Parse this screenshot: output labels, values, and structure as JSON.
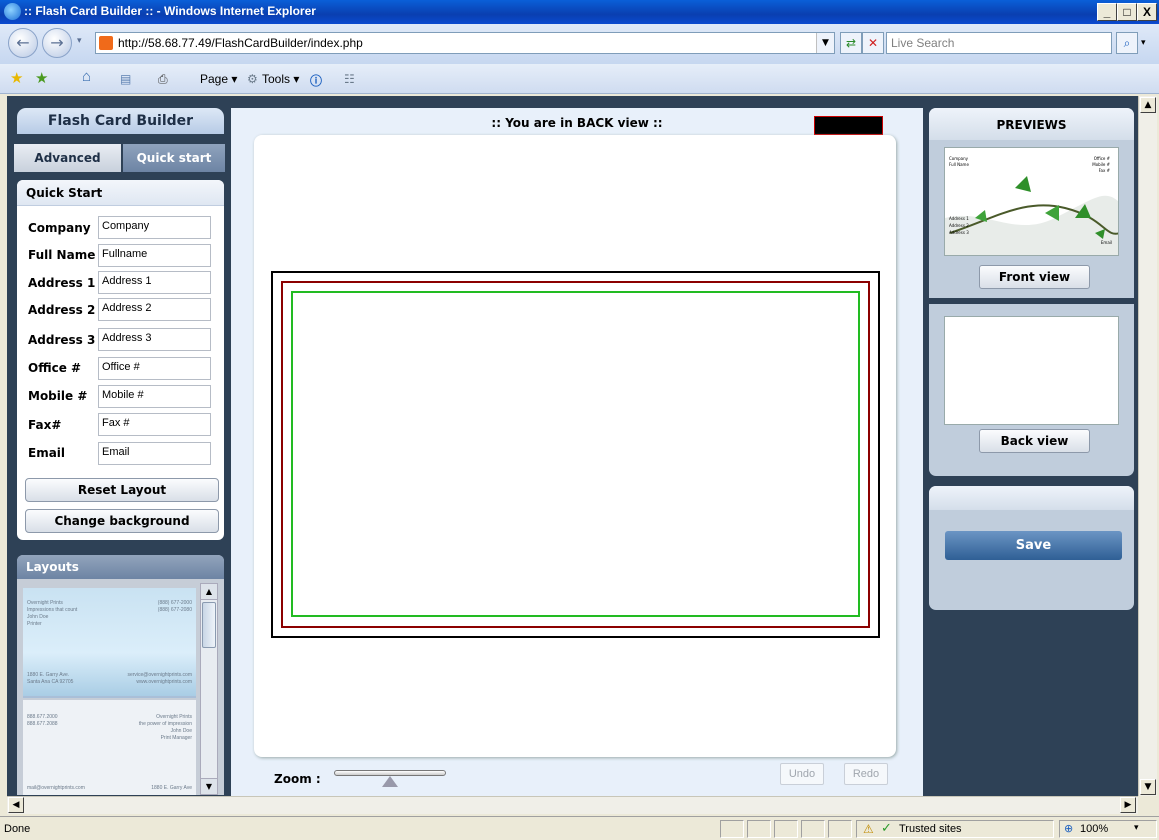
{
  "window": {
    "title": ":: Flash Card Builder :: - Windows Internet Explorer",
    "min": "_",
    "max": "□",
    "close": "X"
  },
  "browser": {
    "url": "http://58.68.77.49/FlashCardBuilder/index.php",
    "search_placeholder": "Live Search",
    "commands": {
      "page": "Page ▾",
      "tools": "Tools ▾"
    }
  },
  "left_panel": {
    "title": "Flash Card Builder",
    "tabs": [
      "Advanced",
      "Quick start"
    ],
    "quick_start_heading": "Quick Start",
    "fields": [
      {
        "label": "Company",
        "value": "Company"
      },
      {
        "label": "Full Name",
        "value": "Fullname"
      },
      {
        "label": "Address 1",
        "value": "Address 1"
      },
      {
        "label": "Address 2",
        "value": "Address 2"
      },
      {
        "label": "Address 3",
        "value": "Address 3"
      },
      {
        "label": "Office #",
        "value": "Office #"
      },
      {
        "label": "Mobile #",
        "value": "Mobile #"
      },
      {
        "label": "Fax#",
        "value": "Fax #"
      },
      {
        "label": "Email",
        "value": "Email"
      }
    ],
    "reset_label": "Reset Layout",
    "change_bg_label": "Change background",
    "layouts_heading": "Layouts",
    "layout_thumbs": [
      {
        "l1": "Overnight Prints",
        "l2": "Impressions that count",
        "l3": "John Doe",
        "l4": "Printer",
        "r1": "(888) 677-2000",
        "r2": "(888) 677-2080",
        "b1": "1880 E. Garry Ave.",
        "b2": "Santa Ana CA 92705",
        "b3": "service@overnightprints.com",
        "b4": "www.overnightprints.com"
      },
      {
        "l1": "888.677.2000",
        "l2": "888.677.2088",
        "r1": "Overnight Prints",
        "r2": "the power of impression",
        "r3": "John Doe",
        "r4": "Print Manager",
        "b1": "mail@overnightprints.com",
        "b2": "1880 E. Garry Ave"
      }
    ]
  },
  "center": {
    "view_title": ":: You are in BACK view ::",
    "zoom_label": "Zoom :",
    "zoom_level": 0.5,
    "undo": "Undo",
    "redo": "Redo"
  },
  "right_panel": {
    "heading": "PREVIEWS",
    "front_preview_text": {
      "company": "Company",
      "fullname": "Full Name",
      "office": "Office #",
      "mobile": "Mobile #",
      "fax": "Fax #",
      "addr1": "Address 1",
      "addr2": "Address 2",
      "addr3": "Address 3",
      "email": "Email"
    },
    "front_view_label": "Front view",
    "back_view_label": "Back view",
    "save_label": "Save"
  },
  "status": {
    "text": "Done",
    "zone": "Trusted sites",
    "zoom": "100%"
  },
  "colors": {
    "page_bg": "#2e4156",
    "accent": "#2f5f95",
    "card_outer": "#000000",
    "card_bleed": "#8b0000",
    "card_safe": "#22bb22"
  }
}
